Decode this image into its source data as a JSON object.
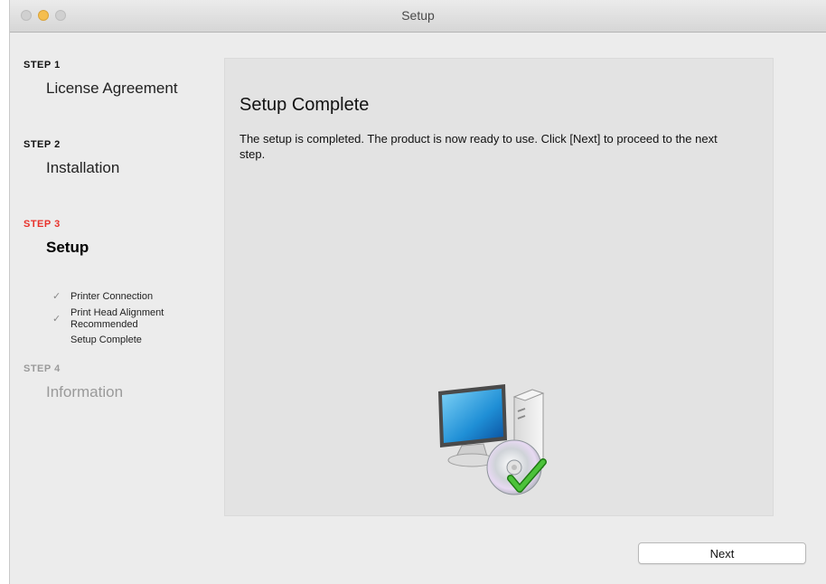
{
  "window": {
    "title": "Setup"
  },
  "sidebar": {
    "steps": [
      {
        "label": "STEP 1",
        "title": "License Agreement",
        "state": "done"
      },
      {
        "label": "STEP 2",
        "title": "Installation",
        "state": "done"
      },
      {
        "label": "STEP 3",
        "title": "Setup",
        "state": "active"
      },
      {
        "label": "STEP 4",
        "title": "Information",
        "state": "disabled"
      }
    ],
    "substeps": [
      {
        "text": "Printer Connection",
        "checked": true
      },
      {
        "text": "Print Head Alignment Recommended",
        "checked": true
      },
      {
        "text": "Setup Complete",
        "checked": false
      }
    ]
  },
  "main": {
    "heading": "Setup Complete",
    "message": "The setup is completed. The product is now ready to use. Click [Next] to proceed to the next step.",
    "illustration": "computer-cd-check-icon"
  },
  "buttons": {
    "next": "Next"
  },
  "colors": {
    "active_step": "#e8322b",
    "panel_bg": "#e3e3e3",
    "window_bg": "#ececec"
  }
}
